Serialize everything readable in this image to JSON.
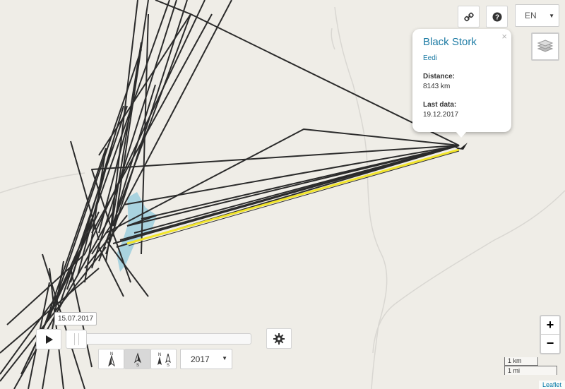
{
  "popup": {
    "title": "Black Stork",
    "name": "Eedi",
    "distance_label": "Distance:",
    "distance_value": "8143 km",
    "last_label": "Last data:",
    "last_value": "19.12.2017",
    "close_glyph": "×"
  },
  "controls": {
    "link_icon": "link-icon",
    "help_icon": "question-circle-icon",
    "language": "EN",
    "layers_icon": "layers-icon",
    "zoom_in": "+",
    "zoom_out": "−",
    "settings_icon": "gear-icon",
    "play_icon": "play-icon"
  },
  "timeline": {
    "date": "15.07.2017",
    "year": "2017",
    "progress": 0.0
  },
  "compass": {
    "n": "N",
    "s": "S"
  },
  "scale": {
    "km": "1 km",
    "mi": "1 mi"
  },
  "attribution": "Leaflet",
  "colors": {
    "track": "#2b2b2b",
    "highlight_track": "#f2e52b",
    "water": "#a9d3df",
    "link": "#1d7ba4"
  }
}
